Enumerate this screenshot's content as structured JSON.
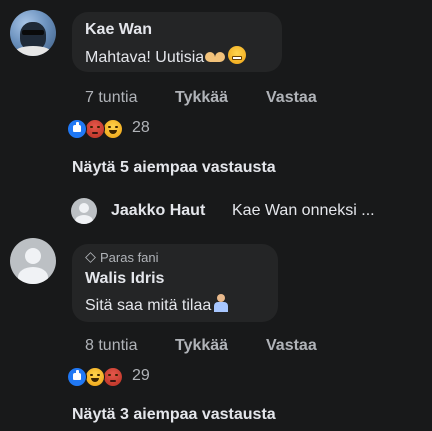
{
  "comments": [
    {
      "author": "Kae Wan",
      "text": "Mahtava! Uutisia",
      "time": "7 tuntia",
      "like_label": "Tykkää",
      "reply_label": "Vastaa",
      "reaction_count": "28",
      "reactions": [
        "like",
        "angry",
        "laugh"
      ],
      "more_replies": "Näytä 5 aiempaa vastausta",
      "latest_reply": {
        "author": "Jaakko Haut",
        "text": "Kae Wan onneksi ..."
      }
    },
    {
      "badge": "Paras fani",
      "author": "Walis Idris",
      "text": "Sitä saa mitä tilaa",
      "time": "8 tuntia",
      "like_label": "Tykkää",
      "reply_label": "Vastaa",
      "reaction_count": "29",
      "reactions": [
        "like",
        "laugh",
        "angry"
      ],
      "more_replies": "Näytä 3 aiempaa vastausta"
    }
  ],
  "colors": {
    "background": "#18191a",
    "bubble": "#242526",
    "text_primary": "#e4e6eb",
    "text_secondary": "#b0b3b8",
    "like_blue": "#2078f4"
  }
}
